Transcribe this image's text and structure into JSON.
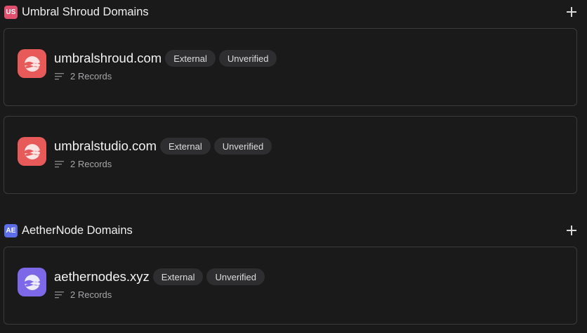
{
  "groups": [
    {
      "badge": "US",
      "badge_color": "#e0506e",
      "title": "Umbral Shroud Domains",
      "domains": [
        {
          "name": "umbralshroud.com",
          "tags": [
            "External",
            "Unverified"
          ],
          "records": "2 Records",
          "icon_color": "#e85a5a",
          "icon": "cloud-logo-icon"
        },
        {
          "name": "umbralstudio.com",
          "tags": [
            "External",
            "Unverified"
          ],
          "records": "2 Records",
          "icon_color": "#e85a5a",
          "icon": "cloud-logo-icon"
        }
      ]
    },
    {
      "badge": "AE",
      "badge_color": "#5b6ee8",
      "title": "AetherNode Domains",
      "domains": [
        {
          "name": "aethernodes.xyz",
          "tags": [
            "External",
            "Unverified"
          ],
          "records": "2 Records",
          "icon_color": "#7d68e8",
          "icon": "cloud-logo-icon"
        }
      ]
    }
  ],
  "add_icon": "plus-icon",
  "records_icon": "list-lines-icon"
}
